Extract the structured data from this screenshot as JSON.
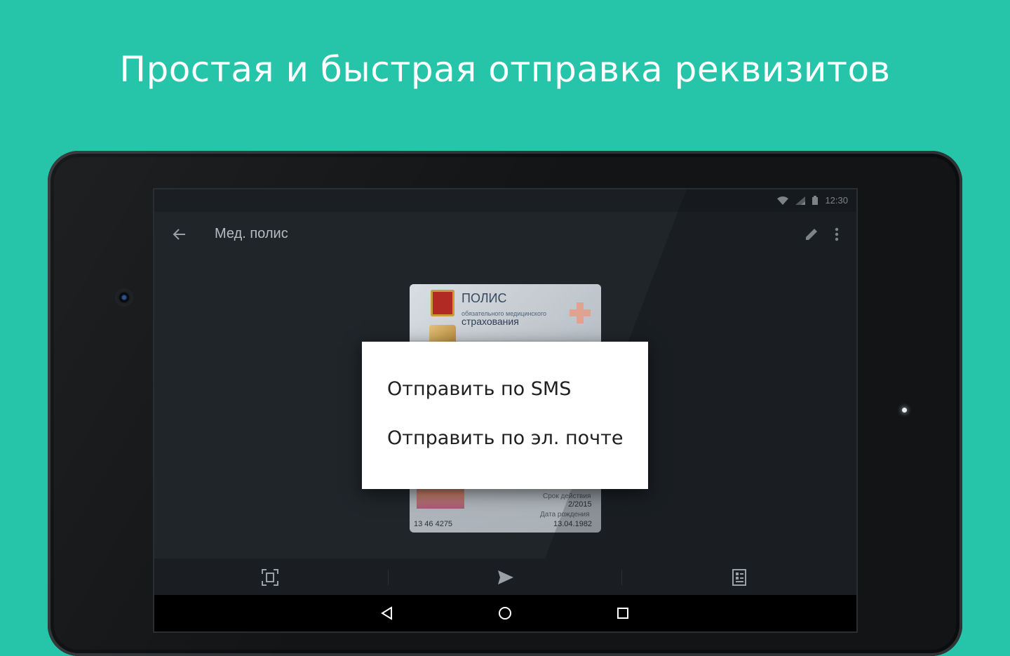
{
  "headline": "Простая и быстрая отправка реквизитов",
  "status_bar": {
    "time": "12:30",
    "icons": [
      "wifi-icon",
      "signal-icon",
      "battery-icon"
    ]
  },
  "app_bar": {
    "title": "Мед. полис",
    "back_icon": "arrow-back-icon",
    "actions": [
      "edit-icon",
      "more-vert-icon"
    ]
  },
  "card": {
    "title": "ПОЛИС",
    "subtitle_small": "обязательного медицинского",
    "subtitle": "страхования",
    "valid_label": "Срок действия",
    "valid_value": "2/2015",
    "birth_label": "Дата рождения",
    "birth_value": "13.04.1982",
    "number": "13 46 4275"
  },
  "dialog": {
    "items": [
      "Отправить по SMS",
      "Отправить по эл. почте"
    ]
  },
  "toolbar": {
    "icons": [
      "scan-frame-icon",
      "send-icon",
      "details-list-icon"
    ]
  },
  "nav": {
    "icons": [
      "nav-back-icon",
      "nav-home-icon",
      "nav-recents-icon"
    ]
  },
  "colors": {
    "background": "#26c4a8",
    "screen": "#20252a",
    "dialog": "#ffffff"
  }
}
